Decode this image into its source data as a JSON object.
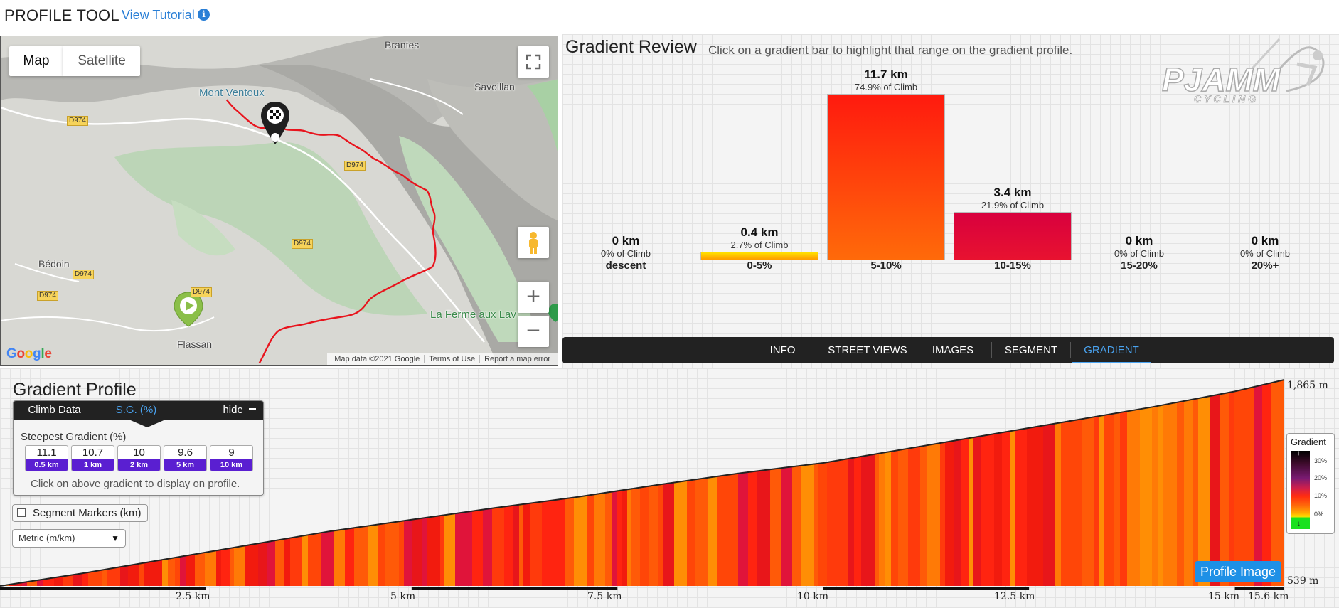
{
  "header": {
    "title": "PROFILE TOOL",
    "tutorial_link": "View Tutorial",
    "info_icon": "info-icon"
  },
  "map": {
    "type_buttons": [
      "Map",
      "Satellite"
    ],
    "active_type": "Map",
    "labels": {
      "ventoux": "Mont Ventoux",
      "brantes": "Brantes",
      "savoillan": "Savoillan",
      "bedoin": "Bédoin",
      "flassan": "Flassan",
      "ferme": "La Ferme aux Lav"
    },
    "road": "D974",
    "google": [
      "G",
      "o",
      "o",
      "g",
      "l",
      "e"
    ],
    "attribution": [
      "Map data ©2021 Google",
      "Terms of Use",
      "Report a map error"
    ],
    "icons": {
      "fullscreen": "fullscreen-icon",
      "pegman": "pegman-icon",
      "zoom_in": "+",
      "zoom_out": "−",
      "start": "start-marker-icon",
      "finish": "finish-flag-marker-icon"
    },
    "colors": {
      "route": "#e8141d"
    }
  },
  "gradient_review": {
    "title": "Gradient Review",
    "hint": "Click on a gradient bar to highlight that range on the gradient profile.",
    "bars": [
      {
        "range": "descent",
        "km": "0 km",
        "pct": "0% of Climb",
        "share": 0.0
      },
      {
        "range": "0-5%",
        "km": "0.4 km",
        "pct": "2.7% of Climb",
        "share": 0.027
      },
      {
        "range": "5-10%",
        "km": "11.7 km",
        "pct": "74.9% of Climb",
        "share": 0.749
      },
      {
        "range": "10-15%",
        "km": "3.4 km",
        "pct": "21.9% of Climb",
        "share": 0.219
      },
      {
        "range": "15-20%",
        "km": "0 km",
        "pct": "0% of Climb",
        "share": 0.0
      },
      {
        "range": "20%+",
        "km": "0 km",
        "pct": "0% of Climb",
        "share": 0.0
      }
    ],
    "tabs": [
      "INFO",
      "STREET VIEWS",
      "IMAGES",
      "SEGMENT",
      "GRADIENT"
    ],
    "active_tab": "GRADIENT",
    "logo": "PJAMM",
    "logo_sub": "CYCLING"
  },
  "gradient_profile": {
    "title": "Gradient Profile",
    "climb_tabs": {
      "data": "Climb Data",
      "sg": "S.G. (%)",
      "hide": "hide"
    },
    "steepest_title": "Steepest Gradient (%)",
    "steepest": [
      {
        "value": "11.1",
        "dist": "0.5 km"
      },
      {
        "value": "10.7",
        "dist": "1 km"
      },
      {
        "value": "10",
        "dist": "2 km"
      },
      {
        "value": "9.6",
        "dist": "5 km"
      },
      {
        "value": "9",
        "dist": "10 km"
      }
    ],
    "steepest_hint": "Click on above gradient to display on profile.",
    "segment_markers": "Segment Markers (km)",
    "segment_markers_checked": false,
    "units": "Metric (m/km)",
    "elevation_top": "1,865 m",
    "elevation_bottom": "539 m",
    "km_labels": [
      "2.5 km",
      "5 km",
      "7.5 km",
      "10 km",
      "12.5 km",
      "15 km",
      "15.6 km"
    ],
    "legend": {
      "title": "Gradient",
      "ticks": [
        "30%",
        "20%",
        "10%",
        "0%"
      ]
    },
    "profile_image_button": "Profile Image",
    "chart_data": {
      "type": "area",
      "xlabel": "",
      "ylabel": "",
      "xlim": [
        0,
        15.6
      ],
      "ylim": [
        539,
        1865
      ],
      "x_ticks": [
        "2.5 km",
        "5 km",
        "7.5 km",
        "10 km",
        "12.5 km",
        "15 km",
        "15.6 km"
      ],
      "distance_km": [
        0,
        1,
        2,
        3,
        4,
        5,
        6,
        7,
        8,
        9,
        10,
        11,
        12,
        13,
        14,
        15,
        15.6
      ],
      "elevation_m": [
        539,
        620,
        710,
        800,
        890,
        965,
        1040,
        1110,
        1190,
        1265,
        1330,
        1420,
        1510,
        1600,
        1690,
        1790,
        1865
      ]
    }
  }
}
